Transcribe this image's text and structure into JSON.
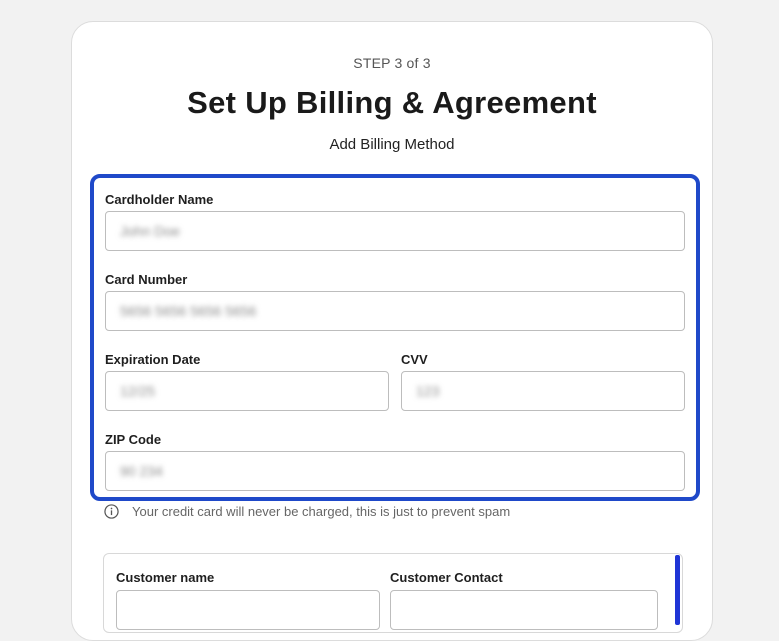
{
  "header": {
    "step": "STEP 3 of 3",
    "title": "Set Up Billing & Agreement",
    "subtitle": "Add Billing Method"
  },
  "billing": {
    "cardholder_name": {
      "label": "Cardholder Name",
      "placeholder": "John Doe"
    },
    "card_number": {
      "label": "Card Number",
      "placeholder": "5656 5656 5656 5656"
    },
    "expiration_date": {
      "label": "Expiration Date",
      "placeholder": "12/25"
    },
    "cvv": {
      "label": "CVV",
      "placeholder": "123"
    },
    "zip_code": {
      "label": "ZIP Code",
      "placeholder": "90 234"
    },
    "note": "Your credit card will never be charged, this is just to prevent spam"
  },
  "customer": {
    "name_label": "Customer name",
    "contact_label": "Customer Contact"
  },
  "colors": {
    "focus_border": "#1f49c9",
    "accent_bar": "#1f35d6",
    "background": "#f2f2f2"
  },
  "icons": {
    "note_icon": "info-icon"
  }
}
